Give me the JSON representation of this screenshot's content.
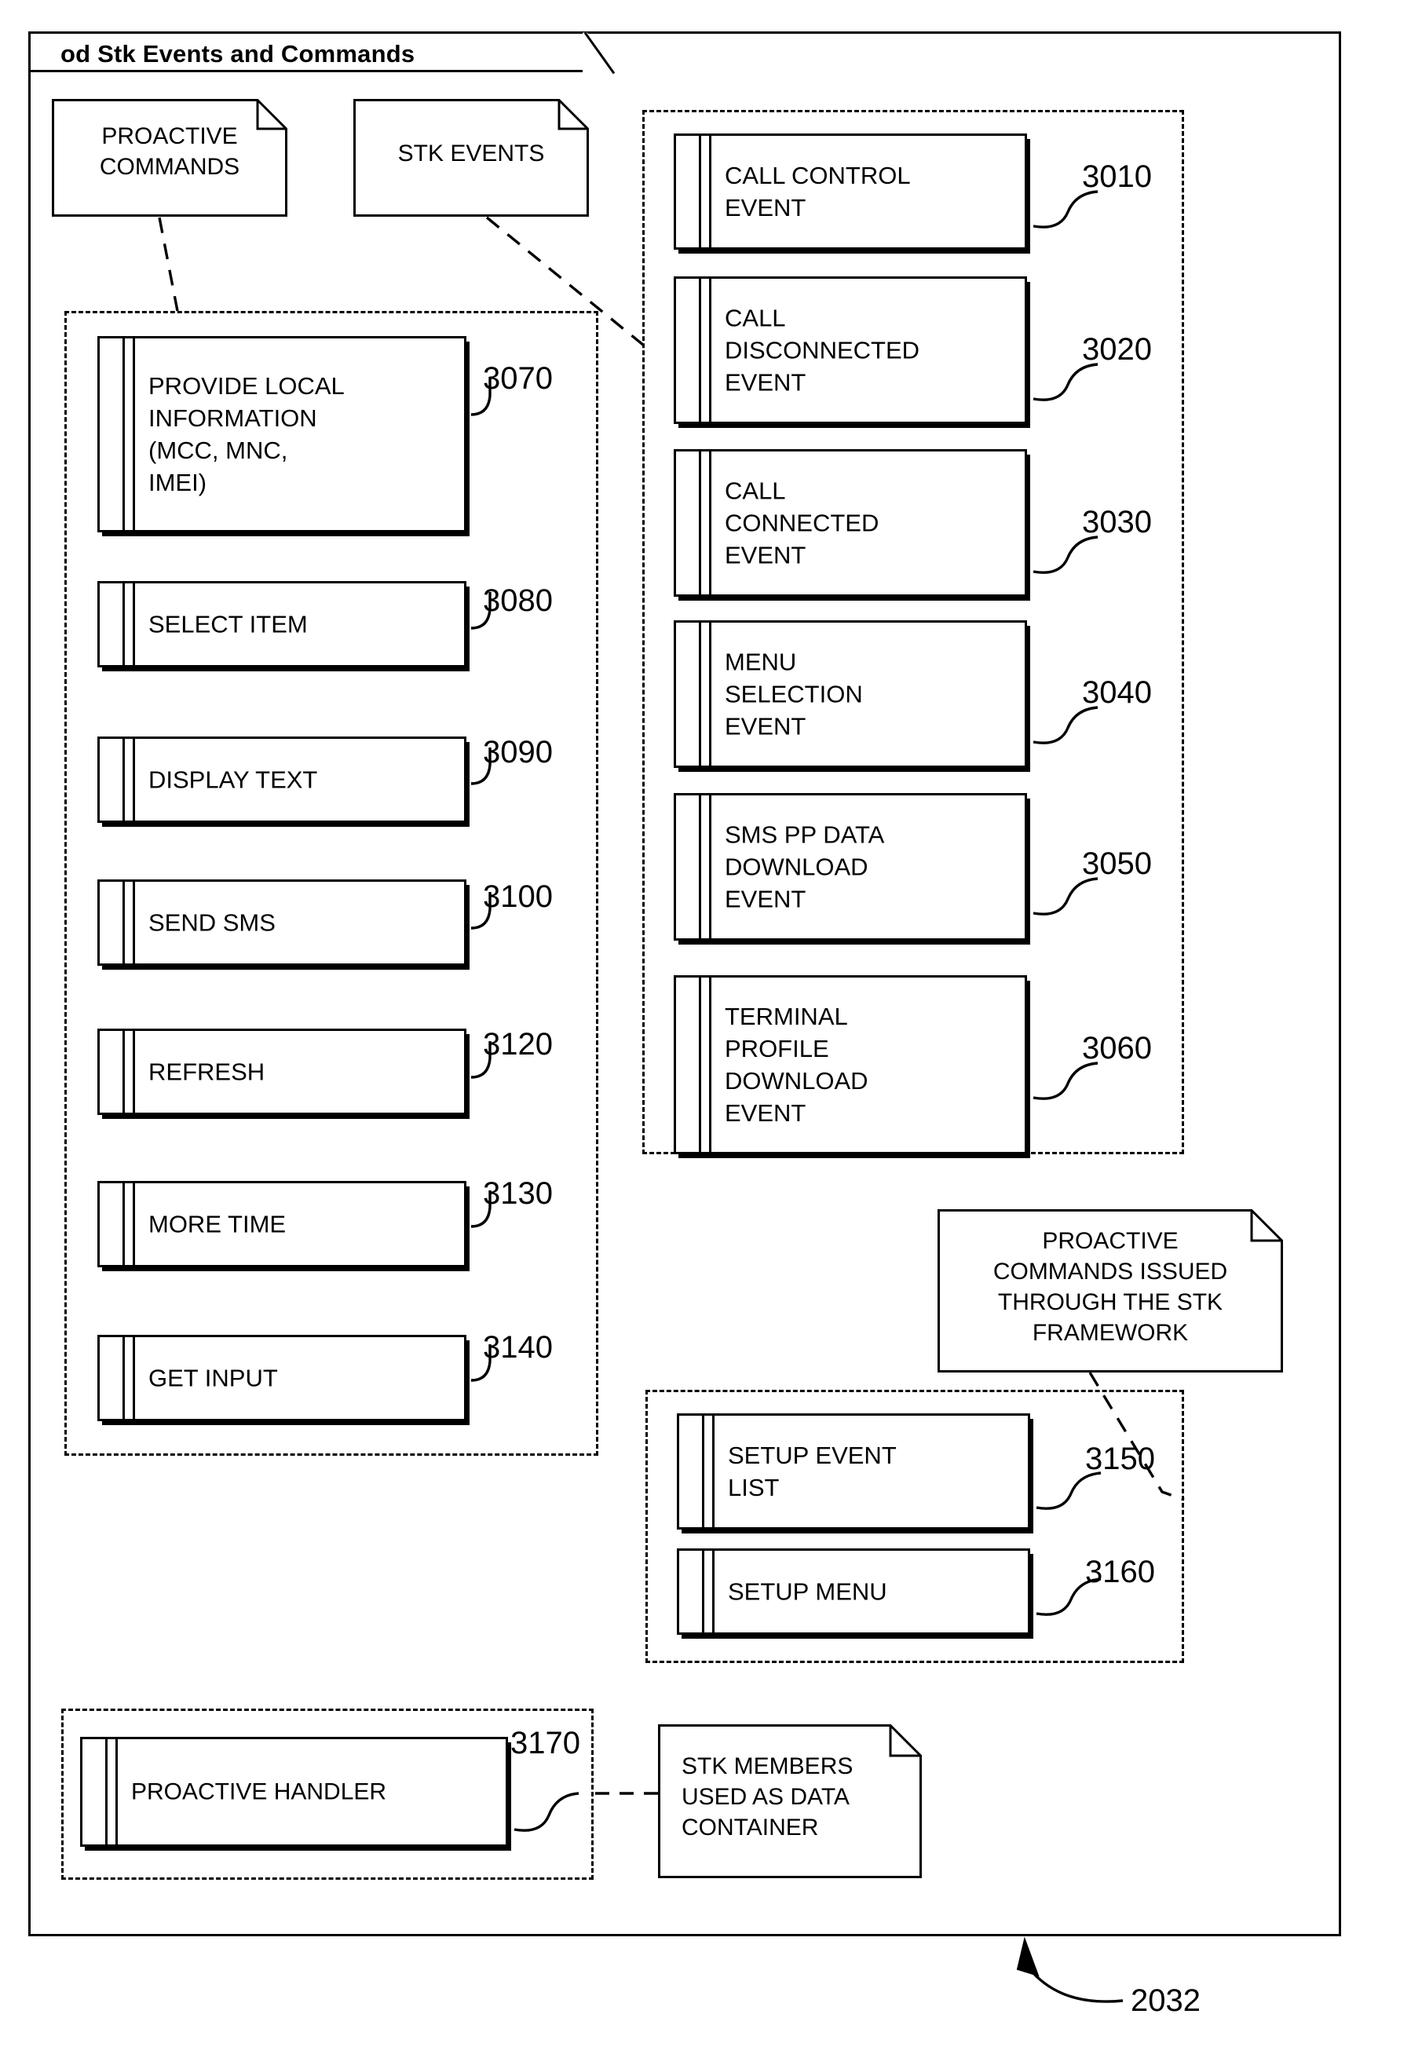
{
  "diagram": {
    "title": "od Stk Events and Commands",
    "bottom_reference": "2032"
  },
  "notes": [
    {
      "id": "note-proactive-commands",
      "text": "PROACTIVE\nCOMMANDS"
    },
    {
      "id": "note-stk-events",
      "text": "STK EVENTS"
    },
    {
      "id": "note-proactive-commands-issued",
      "text": "PROACTIVE\nCOMMANDS ISSUED\nTHROUGH THE STK\nFRAMEWORK"
    },
    {
      "id": "note-stk-members",
      "text": "STK MEMBERS\nUSED AS DATA\nCONTAINER"
    }
  ],
  "groups": {
    "proactive_commands_group": {
      "components": [
        {
          "label": "PROVIDE LOCAL\nINFORMATION\n(MCC, MNC,\nIMEI)",
          "ref": "3070"
        },
        {
          "label": "SELECT ITEM",
          "ref": "3080"
        },
        {
          "label": "DISPLAY TEXT",
          "ref": "3090"
        },
        {
          "label": "SEND SMS",
          "ref": "3100"
        },
        {
          "label": "REFRESH",
          "ref": "3120"
        },
        {
          "label": "MORE TIME",
          "ref": "3130"
        },
        {
          "label": "GET INPUT",
          "ref": "3140"
        }
      ]
    },
    "stk_events_group": {
      "components": [
        {
          "label": "CALL CONTROL\nEVENT",
          "ref": "3010"
        },
        {
          "label": "CALL\nDISCONNECTED\nEVENT",
          "ref": "3020"
        },
        {
          "label": "CALL\nCONNECTED\nEVENT",
          "ref": "3030"
        },
        {
          "label": "MENU\nSELECTION\nEVENT",
          "ref": "3040"
        },
        {
          "label": "SMS PP DATA\nDOWNLOAD\nEVENT",
          "ref": "3050"
        },
        {
          "label": "TERMINAL\nPROFILE\nDOWNLOAD\nEVENT",
          "ref": "3060"
        }
      ]
    },
    "setup_group": {
      "components": [
        {
          "label": "SETUP EVENT\nLIST",
          "ref": "3150"
        },
        {
          "label": "SETUP MENU",
          "ref": "3160"
        }
      ]
    },
    "handler_group": {
      "components": [
        {
          "label": "PROACTIVE HANDLER",
          "ref": "3170"
        }
      ]
    }
  }
}
